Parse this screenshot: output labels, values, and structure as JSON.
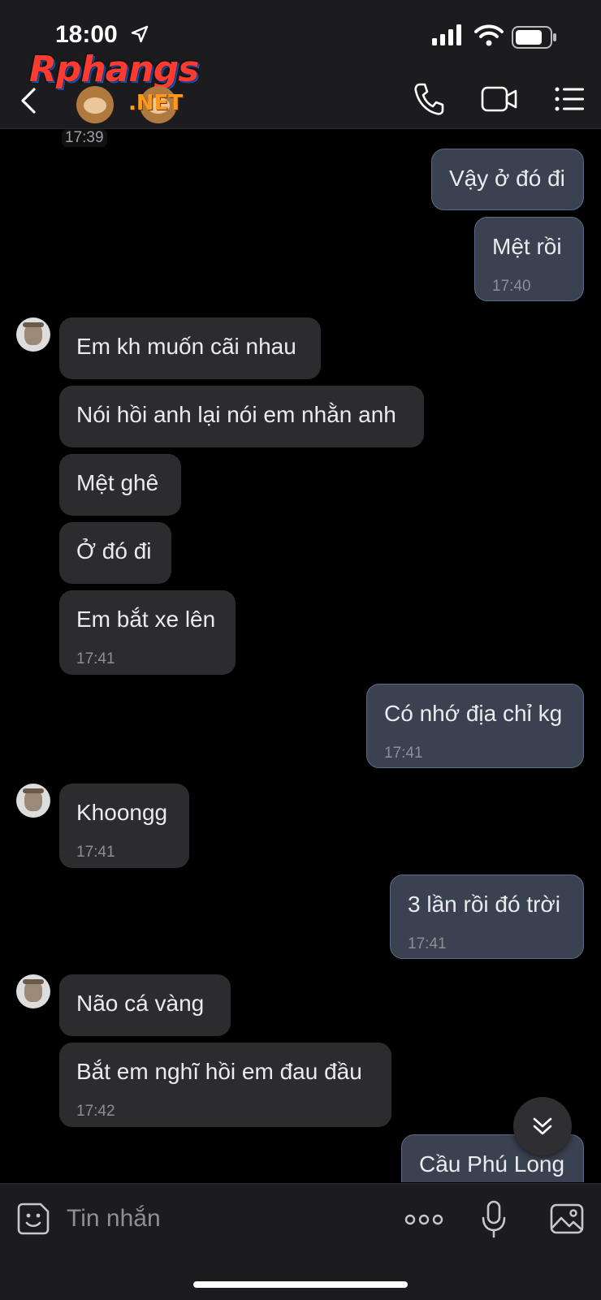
{
  "status": {
    "time": "18:00"
  },
  "header": {
    "logo_main": "Rphangs",
    "logo_suffix": ".NET"
  },
  "chat": {
    "top_timestamp": "17:39",
    "messages": [
      {
        "side": "out",
        "text": "Vậy ở đó đi",
        "time": ""
      },
      {
        "side": "out",
        "text": "Mệt rồi",
        "time": "17:40"
      },
      {
        "side": "in",
        "text": "Em kh muốn cãi nhau",
        "time": ""
      },
      {
        "side": "in",
        "text": "Nói hồi anh lại nói em nhằn anh",
        "time": ""
      },
      {
        "side": "in",
        "text": "Mệt ghê",
        "time": ""
      },
      {
        "side": "in",
        "text": "Ở đó đi",
        "time": ""
      },
      {
        "side": "in",
        "text": "Em bắt xe lên",
        "time": "17:41"
      },
      {
        "side": "out",
        "text": "Có nhớ địa chỉ kg",
        "time": "17:41"
      },
      {
        "side": "in",
        "text": "Khoongg",
        "time": "17:41"
      },
      {
        "side": "out",
        "text": "3 lần rồi đó trời",
        "time": "17:41"
      },
      {
        "side": "in",
        "text": "Não cá vàng",
        "time": ""
      },
      {
        "side": "in",
        "text": "Bắt em nghĩ hồi em đau đầu",
        "time": "17:42"
      },
      {
        "side": "out",
        "text": "Cầu Phú Long",
        "time": ""
      }
    ]
  },
  "composer": {
    "placeholder": "Tin nhắn"
  },
  "colors": {
    "background": "#000000",
    "incoming": "#2c2c2e",
    "outgoing": "#3a4150",
    "outgoing_border": "#5b6b86"
  }
}
